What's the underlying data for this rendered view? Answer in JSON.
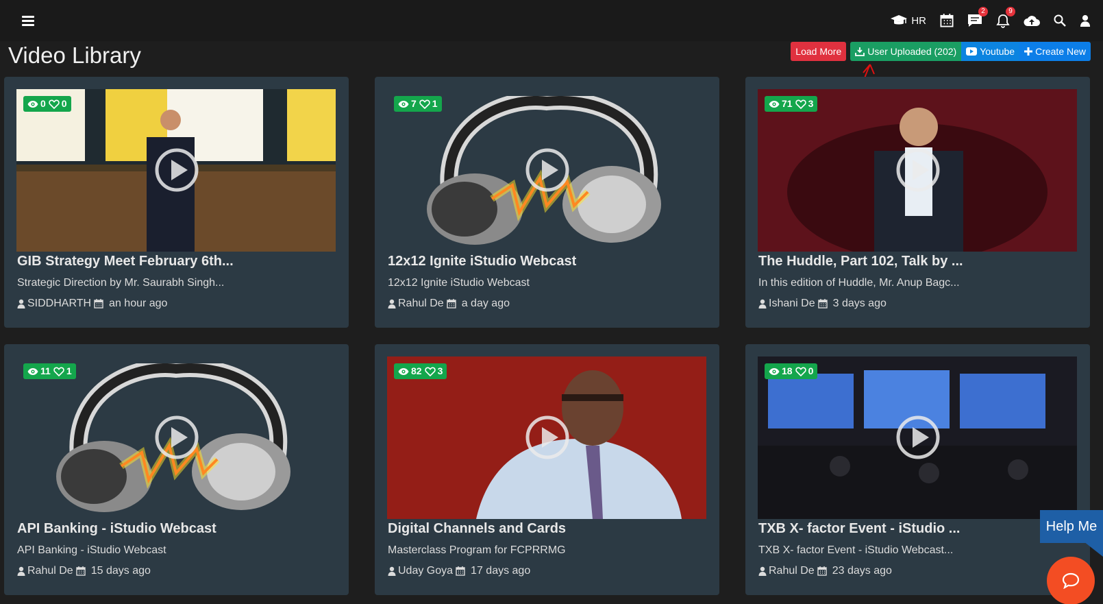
{
  "nav": {
    "hr_label": "HR",
    "chat_badge": "2",
    "notification_badge": "9"
  },
  "page_title": "Video Library",
  "actions": {
    "load_more": "Load More",
    "user_uploaded": "User Uploaded (202)",
    "youtube": "Youtube",
    "create_new": "Create New"
  },
  "videos": [
    {
      "views": "0",
      "likes": "0",
      "title": "GIB Strategy Meet February 6th...",
      "description": "Strategic Direction by Mr. Saurabh Singh...",
      "author": "SIDDHARTH",
      "time": "an hour ago"
    },
    {
      "views": "7",
      "likes": "1",
      "title": "12x12 Ignite iStudio Webcast",
      "description": "12x12 Ignite iStudio Webcast",
      "author": "Rahul De",
      "time": "a day ago"
    },
    {
      "views": "71",
      "likes": "3",
      "title": "The Huddle, Part 102, Talk by ...",
      "description": "In this edition of Huddle, Mr. Anup Bagc...",
      "author": "Ishani De",
      "time": "3 days ago"
    },
    {
      "views": "11",
      "likes": "1",
      "title": "API Banking - iStudio Webcast",
      "description": "API Banking - iStudio Webcast",
      "author": "Rahul De",
      "time": "15 days ago"
    },
    {
      "views": "82",
      "likes": "3",
      "title": "Digital Channels and Cards",
      "description": "Masterclass Program for FCPRRMG",
      "author": "Uday Goya",
      "time": "17 days ago"
    },
    {
      "views": "18",
      "likes": "0",
      "title": "TXB X- factor Event - iStudio ...",
      "description": "TXB X- factor Event - iStudio Webcast...",
      "author": "Rahul De",
      "time": "23 days ago"
    }
  ],
  "help": {
    "label": "Help Me"
  },
  "colors": {
    "topbar": "#1a1a1a",
    "card": "#2c3a44",
    "load_more": "#e0313f",
    "user_uploaded": "#1a9e63",
    "youtube": "#0c84e0",
    "create_new": "#0c7ee8",
    "stats_badge": "#14a64c",
    "help": "#1e5fa6",
    "chat": "#f34d23"
  }
}
